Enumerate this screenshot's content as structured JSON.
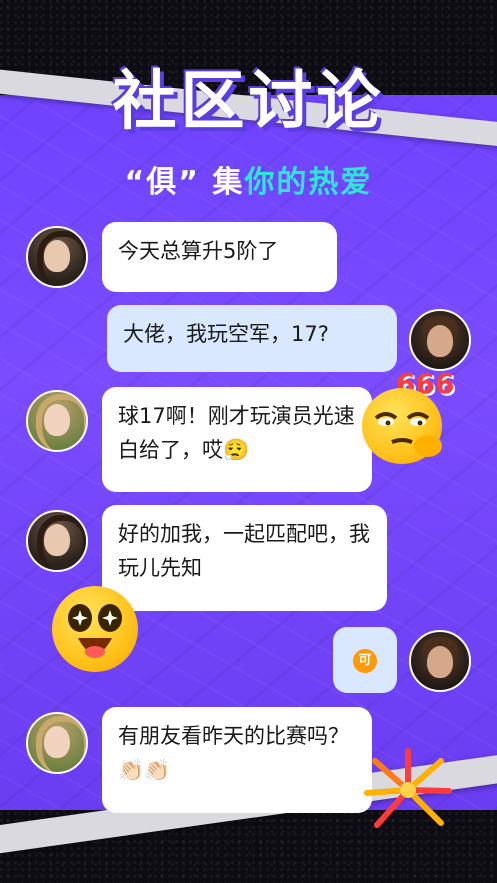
{
  "header": {
    "title": "社区讨论",
    "subtitle_part1": "“俱” 集",
    "subtitle_part2": "你的热爱"
  },
  "messages": [
    {
      "side": "left",
      "text": "今天总算升5阶了"
    },
    {
      "side": "right",
      "text": "大佬，我玩空军，17?"
    },
    {
      "side": "left",
      "text": "球17啊！刚才玩演员光速白给了，哎😮‍💨"
    },
    {
      "side": "left",
      "text": "好的加我，一起匹配吧，我玩儿先知"
    },
    {
      "side": "right",
      "text": "可"
    },
    {
      "side": "left",
      "text": "有朋友看昨天的比赛吗？👏🏻👏🏻"
    }
  ],
  "decor": {
    "badge_666": "666",
    "coin_label": "可"
  }
}
